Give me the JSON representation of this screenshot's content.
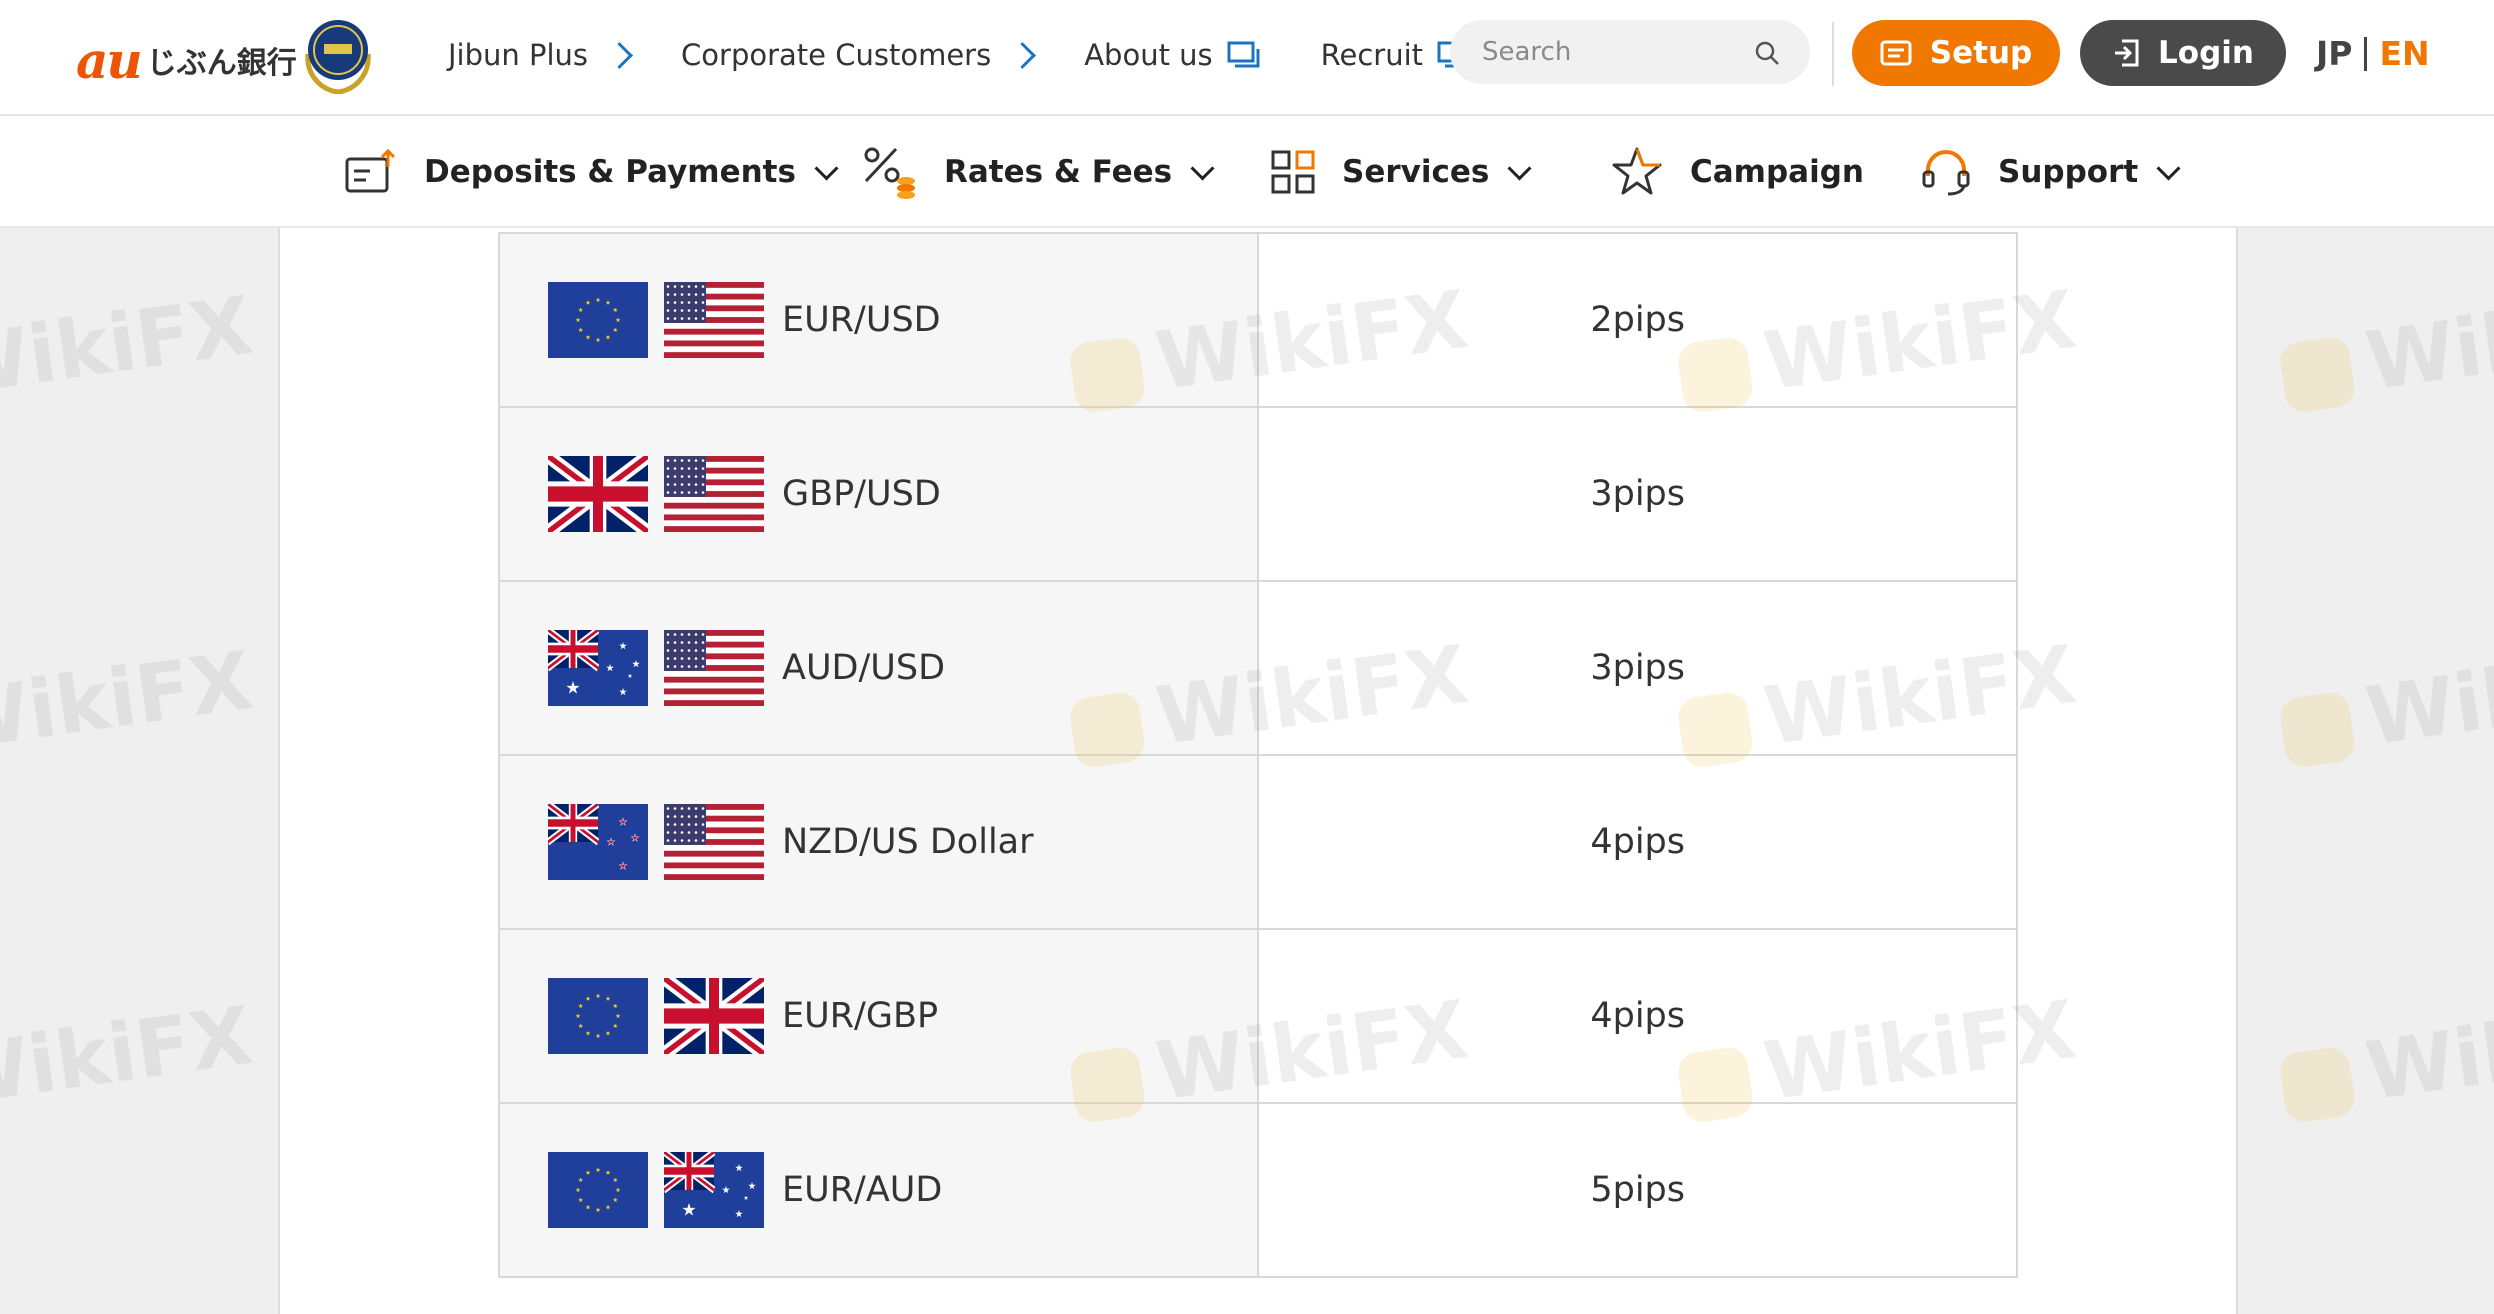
{
  "header": {
    "logo_mark": "au",
    "logo_text": "じぶん銀行",
    "nav": [
      {
        "label": "Jibun Plus"
      },
      {
        "label": "Corporate Customers"
      },
      {
        "label": "About us"
      },
      {
        "label": "Recruit"
      }
    ],
    "search": {
      "placeholder": "Search"
    },
    "setup_label": "Setup",
    "login_label": "Login",
    "lang": {
      "jp": "JP",
      "en": "EN"
    }
  },
  "main_nav": [
    {
      "label": "Deposits & Payments",
      "icon": "deposit-icon"
    },
    {
      "label": "Rates & Fees",
      "icon": "percent-coin-icon"
    },
    {
      "label": "Services",
      "icon": "grid-icon"
    },
    {
      "label": "Campaign",
      "icon": "star-icon"
    },
    {
      "label": "Support",
      "icon": "headset-icon"
    }
  ],
  "watermark": "WikiFX",
  "rates_table": {
    "rows": [
      {
        "pair": "EUR/USD",
        "spread": "2pips",
        "flags": [
          "EU",
          "US"
        ]
      },
      {
        "pair": "GBP/USD",
        "spread": "3pips",
        "flags": [
          "GB",
          "US"
        ]
      },
      {
        "pair": "AUD/USD",
        "spread": "3pips",
        "flags": [
          "AU",
          "US"
        ]
      },
      {
        "pair": "NZD/US Dollar",
        "spread": "4pips",
        "flags": [
          "NZ",
          "US"
        ]
      },
      {
        "pair": "EUR/GBP",
        "spread": "4pips",
        "flags": [
          "EU",
          "GB"
        ]
      },
      {
        "pair": "EUR/AUD",
        "spread": "5pips",
        "flags": [
          "EU",
          "AU"
        ]
      }
    ]
  },
  "colors": {
    "brand_orange": "#f07800",
    "login_gray": "#4a4a4a",
    "link_blue": "#1e73be"
  }
}
